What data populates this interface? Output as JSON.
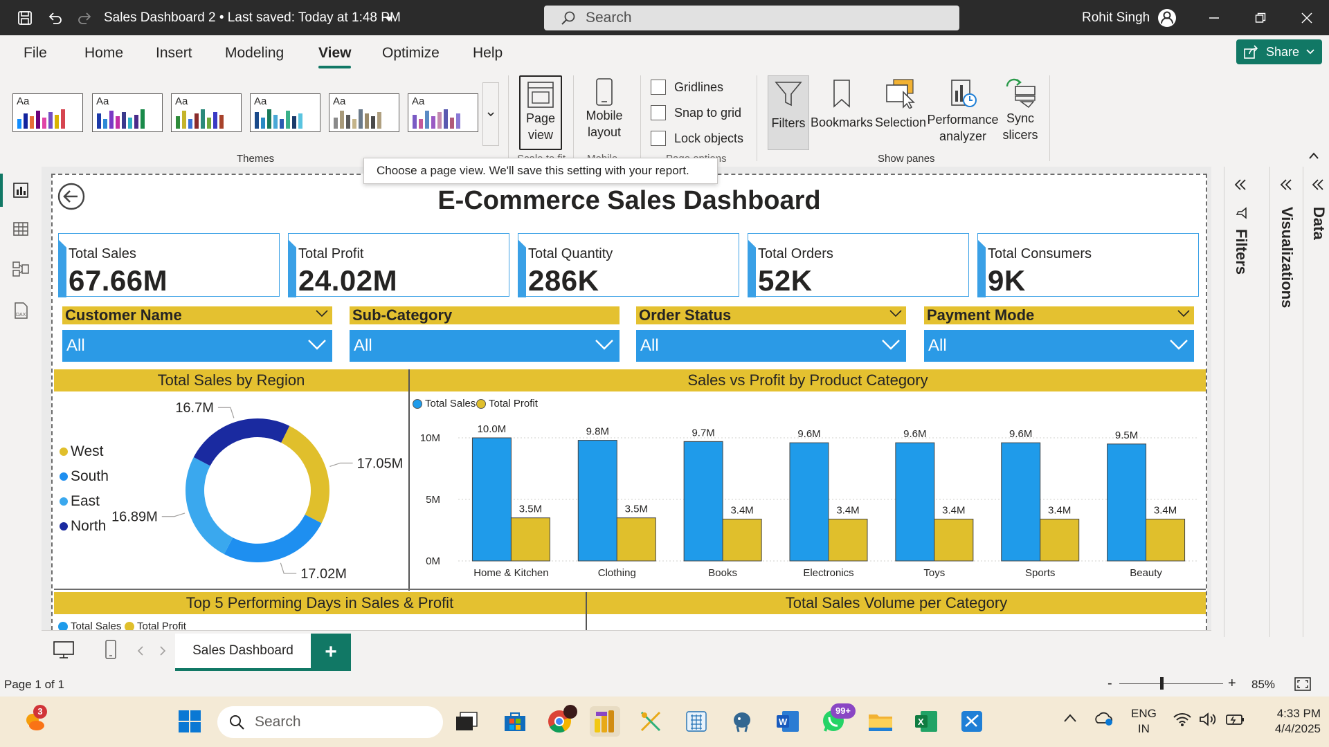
{
  "titlebar": {
    "doc_title": "Sales Dashboard 2 • Last saved: Today at 1:48 PM",
    "search_placeholder": "Search",
    "user_name": "Rohit Singh"
  },
  "menu": {
    "items": [
      "File",
      "Home",
      "Insert",
      "Modeling",
      "View",
      "Optimize",
      "Help"
    ],
    "active": "View",
    "share_label": "Share"
  },
  "ribbon": {
    "theme_sample": "Aa",
    "themes_label": "Themes",
    "page_view_label_1": "Page",
    "page_view_label_2": "view",
    "scale_label": "Scale to fit",
    "mobile_layout_1": "Mobile",
    "mobile_layout_2": "layout",
    "mobile_group": "Mobile",
    "checkboxes": [
      "Gridlines",
      "Snap to grid",
      "Lock objects"
    ],
    "page_options_label": "Page options",
    "show_panes": {
      "filters": "Filters",
      "bookmarks": "Bookmarks",
      "selection": "Selection",
      "performance_1": "Performance",
      "performance_2": "analyzer",
      "sync_1": "Sync",
      "sync_2": "slicers",
      "group_label": "Show panes"
    },
    "tooltip": "Choose a page view. We'll save this setting with your report."
  },
  "report": {
    "title": "E-Commerce Sales Dashboard",
    "cards": [
      {
        "label": "Total Sales",
        "value": "67.66M"
      },
      {
        "label": "Total Profit",
        "value": "24.02M"
      },
      {
        "label": "Total Quantity",
        "value": "286K"
      },
      {
        "label": "Total Orders",
        "value": "52K"
      },
      {
        "label": "Total Consumers",
        "value": "9K"
      }
    ],
    "slicers": [
      {
        "label": "Customer Name",
        "value": "All"
      },
      {
        "label": "Sub-Category",
        "value": "All"
      },
      {
        "label": "Order Status",
        "value": "All"
      },
      {
        "label": "Payment Mode",
        "value": "All"
      }
    ],
    "region_chart_title": "Total Sales by Region",
    "category_chart_title": "Sales vs Profit by Product Category",
    "top5_title": "Top 5 Performing Days in Sales & Profit",
    "volume_title": "Total Sales Volume per Category",
    "legend_sales": "Total Sales",
    "legend_profit": "Total Profit"
  },
  "colors": {
    "accent": "#117865",
    "yellow": "#e4c130",
    "blue": "#2b9ae6",
    "sales_bar": "#1f9bea",
    "profit_bar": "#e0bf2c",
    "navy": "#1a2aa0"
  },
  "chart_data": [
    {
      "type": "pie",
      "title": "Total Sales by Region",
      "categories": [
        "West",
        "South",
        "East",
        "North"
      ],
      "values": [
        17.05,
        17.02,
        16.89,
        16.7
      ],
      "data_labels": [
        "17.05M",
        "17.02M",
        "16.89M",
        "16.7M"
      ],
      "colors": [
        "#e0bf2c",
        "#1e8ff0",
        "#3aa8ee",
        "#1a2aa0"
      ],
      "legend_position": "left"
    },
    {
      "type": "bar",
      "title": "Sales vs Profit by Product Category",
      "categories": [
        "Home & Kitchen",
        "Clothing",
        "Books",
        "Electronics",
        "Toys",
        "Sports",
        "Beauty"
      ],
      "series": [
        {
          "name": "Total Sales",
          "values": [
            10.0,
            9.8,
            9.7,
            9.6,
            9.6,
            9.6,
            9.5
          ],
          "labels": [
            "10.0M",
            "9.8M",
            "9.7M",
            "9.6M",
            "9.6M",
            "9.6M",
            "9.5M"
          ]
        },
        {
          "name": "Total Profit",
          "values": [
            3.5,
            3.5,
            3.4,
            3.4,
            3.4,
            3.4,
            3.4
          ],
          "labels": [
            "3.5M",
            "3.5M",
            "3.4M",
            "3.4M",
            "3.4M",
            "3.4M",
            "3.4M"
          ]
        }
      ],
      "yticks": [
        "0M",
        "5M",
        "10M"
      ],
      "ylim": [
        0,
        10
      ],
      "legend_position": "top-left"
    }
  ],
  "pagetabs": {
    "active": "Sales Dashboard",
    "add": "+"
  },
  "statusbar": {
    "page": "Page 1 of 1",
    "minus": "-",
    "plus": "+",
    "zoom": "85%"
  },
  "right_panes": {
    "filters": "Filters",
    "visualizations": "Visualizations",
    "data": "Data"
  },
  "taskbar": {
    "search_placeholder": "Search",
    "lang_1": "ENG",
    "lang_2": "IN",
    "time": "4:33 PM",
    "date": "4/4/2025",
    "weather_badge": "3",
    "whatsapp_badge": "99+"
  }
}
